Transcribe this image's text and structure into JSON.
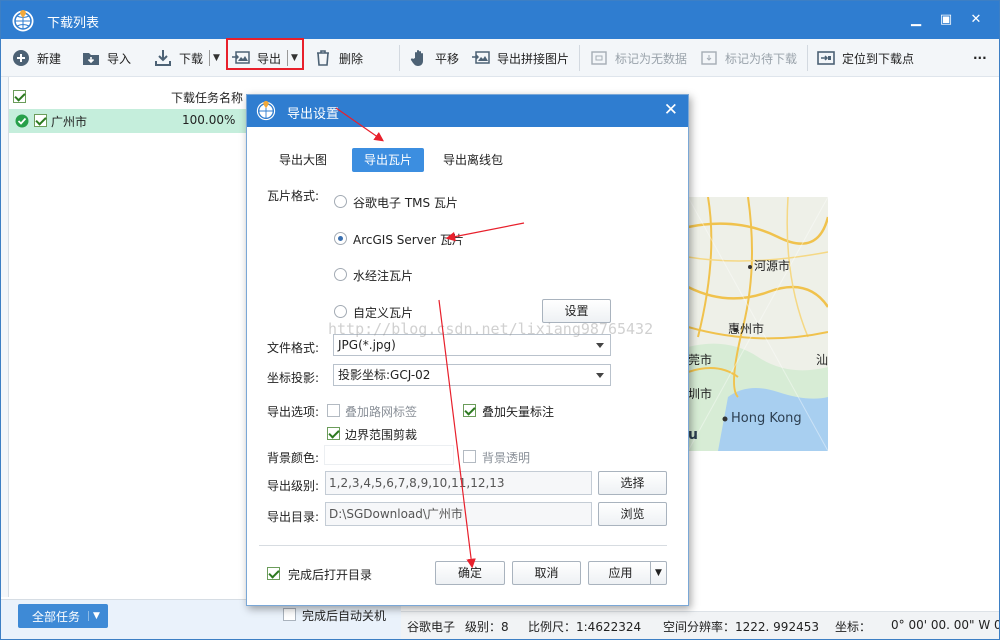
{
  "window": {
    "title": "下载列表"
  },
  "toolbar": {
    "new_label": "新建",
    "import_label": "导入",
    "download_label": "下载",
    "export_label": "导出",
    "delete_label": "删除",
    "pan_label": "平移",
    "export_mosaic_label": "导出拼接图片",
    "mark_nodata_label": "标记为无数据",
    "mark_pending_label": "标记为待下载",
    "locate_label": "定位到下载点",
    "more_label": "···"
  },
  "task_list": {
    "header": "下载任务名称",
    "rows": [
      {
        "name": "广州市",
        "progress": "100.00%"
      }
    ]
  },
  "bottom_left": {
    "all_tasks_label": "全部任务",
    "auto_shutdown_label": "完成后自动关机"
  },
  "map": {
    "labels": {
      "heyuan": "河源市",
      "huizhou": "惠州市",
      "hongkong": "Hong Kong",
      "city_a": "莞市",
      "city_b": "圳市",
      "city_c": "汕",
      "macau": "u"
    }
  },
  "status_bar": {
    "source": "谷歌电子",
    "level": "级别：8",
    "scale": "比例尺：1:4622324",
    "resolution": "空间分辨率：1222. 992453",
    "coord_label": "坐标：",
    "coord_value": "0° 00' 00. 00\"  W  0"
  },
  "dialog": {
    "title": "导出设置",
    "tabs": [
      "导出大图",
      "导出瓦片",
      "导出离线包"
    ],
    "tile_format_label": "瓦片格式:",
    "tile_formats": [
      "谷歌电子 TMS 瓦片",
      "ArcGIS Server 瓦片",
      "水经注瓦片",
      "自定义瓦片"
    ],
    "selected_tile_format": "ArcGIS Server 瓦片",
    "settings_button": "设置",
    "file_format_label": "文件格式:",
    "file_format_value": "JPG(*.jpg)",
    "projection_label": "坐标投影:",
    "projection_value": "投影坐标:GCJ-02",
    "export_options_label": "导出选项:",
    "opt_road_overlay": "叠加路网标签",
    "opt_vector_overlay": "叠加矢量标注",
    "opt_boundary_clip": "边界范围剪裁",
    "bg_color_label": "背景颜色:",
    "bg_transparent_label": "背景透明",
    "levels_label": "导出级别:",
    "levels_value": "1,2,3,4,5,6,7,8,9,10,11,12,13",
    "select_button": "选择",
    "dir_label": "导出目录:",
    "dir_value": "D:\\SGDownload\\广州市",
    "browse_button": "浏览",
    "open_dir_label": "完成后打开目录",
    "ok_button": "确定",
    "cancel_button": "取消",
    "apply_button": "应用"
  },
  "watermark": "http://blog.csdn.net/lixiang98765432",
  "colors": {
    "titlebar": "#2f7dd0",
    "active_tab": "#3c8ee0",
    "row_highlight": "#c5eedc",
    "annotation": "#e8202c"
  }
}
